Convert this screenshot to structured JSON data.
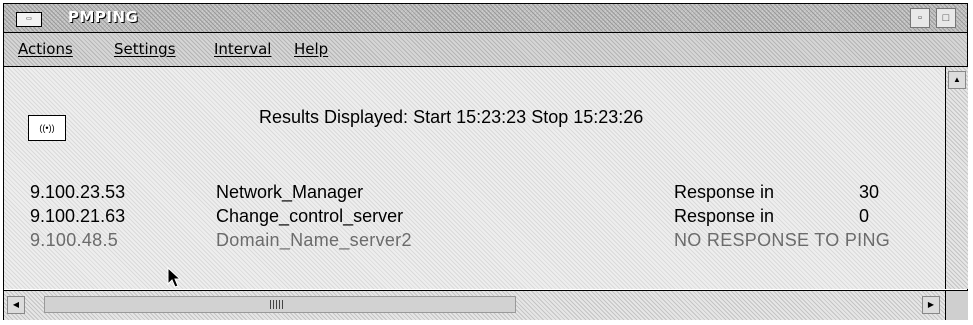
{
  "window": {
    "title": "PMPING",
    "system_menu_icon": "window-menu-icon",
    "buttons": [
      "minimize-icon",
      "maximize-icon"
    ]
  },
  "menu": {
    "items": [
      "Actions",
      "Settings",
      "Interval",
      "Help"
    ]
  },
  "results": {
    "prefix": "Results Displayed:",
    "start_label": "Start",
    "start_time": "15:23:23",
    "stop_label": "Stop",
    "stop_time": "15:23:26"
  },
  "rows": [
    {
      "ip": "9.100.23.53",
      "name": "Network_Manager",
      "status": "Response in",
      "value": "30"
    },
    {
      "ip": "9.100.21.63",
      "name": "Change_control_server",
      "status": "Response in",
      "value": "0"
    },
    {
      "ip": "9.100.48.5",
      "name": "Domain_Name_server2",
      "status": "NO RESPONSE TO PING",
      "value": ""
    }
  ],
  "colors": {
    "responding_text": "#000000",
    "no_response_text": "#6b6b6b"
  },
  "icons": [
    "ping-broadcast-icon",
    "mouse-pointer-icon",
    "scroll-up-icon",
    "scroll-left-icon",
    "scroll-right-icon"
  ]
}
